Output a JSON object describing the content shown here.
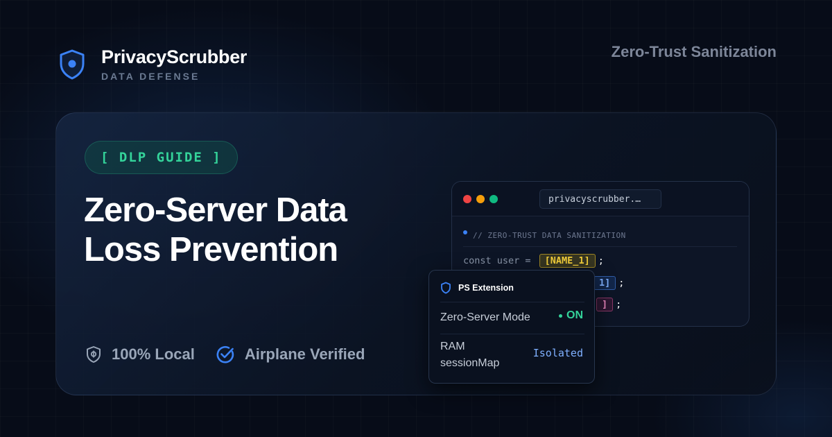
{
  "header": {
    "brand_name": "PrivacyScrubber",
    "brand_sub": "DATA DEFENSE",
    "tagline": "Zero-Trust Sanitization"
  },
  "hero": {
    "badge": "[ DLP GUIDE ]",
    "headline_line1": "Zero-Server Data",
    "headline_line2": "Loss Prevention",
    "features": [
      {
        "label": "100% Local",
        "icon": "shield-lock-icon"
      },
      {
        "label": "Airplane Verified",
        "icon": "check-circle-icon"
      }
    ]
  },
  "browser": {
    "url": "privacyscrubber.…",
    "code_comment": "// ZERO-TRUST DATA SANITIZATION",
    "line1_prefix": "const user = ",
    "line1_token": "[NAME_1]",
    "line1_suffix": ";",
    "line2_token": "1]",
    "line2_suffix": ";",
    "line3_token": "]",
    "line3_suffix": ";"
  },
  "extension": {
    "title": "PS Extension",
    "row1_label": "Zero-Server Mode",
    "row1_value": "ON",
    "row2_label_line1": "RAM",
    "row2_label_line2": "sessionMap",
    "row2_value": "Isolated"
  },
  "colors": {
    "accent_blue": "#3b82f6",
    "accent_green": "#34d39a",
    "dot_red": "#ef4444",
    "dot_amber": "#f59e0b",
    "dot_green": "#10b981"
  }
}
